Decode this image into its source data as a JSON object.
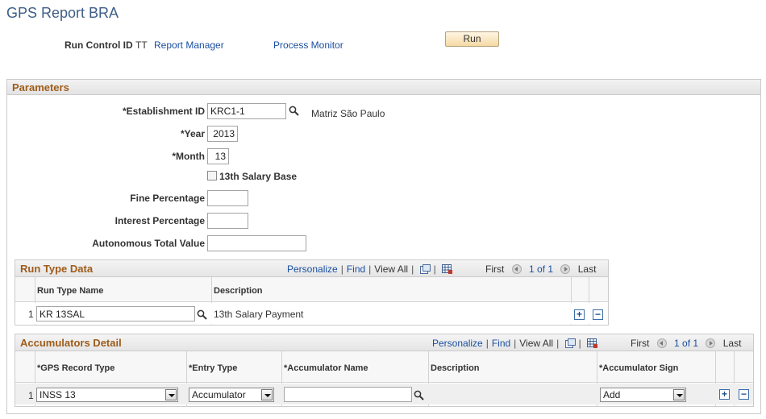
{
  "page": {
    "title": "GPS Report BRA"
  },
  "run_control": {
    "label": "Run Control ID",
    "value": "TT",
    "report_manager": "Report Manager",
    "process_monitor": "Process Monitor",
    "run_button": "Run"
  },
  "parameters": {
    "section_title": "Parameters",
    "establishment": {
      "label": "*Establishment ID",
      "value": "KRC1-1",
      "description": "Matriz São Paulo"
    },
    "year": {
      "label": "*Year",
      "value": "2013"
    },
    "month": {
      "label": "*Month",
      "value": "13"
    },
    "salary_base": {
      "label": "13th Salary Base",
      "checked": false
    },
    "fine_percentage": {
      "label": "Fine Percentage",
      "value": ""
    },
    "interest_percentage": {
      "label": "Interest Percentage",
      "value": ""
    },
    "autonomous_total": {
      "label": "Autonomous Total Value",
      "value": ""
    }
  },
  "run_type_grid": {
    "title": "Run Type Data",
    "nav": {
      "personalize": "Personalize",
      "find": "Find",
      "view_all": "View All",
      "first": "First",
      "count": "1 of 1",
      "last": "Last"
    },
    "columns": [
      "Run Type Name",
      "Description"
    ],
    "rows": [
      {
        "num": "1",
        "run_type_name": "KR 13SAL",
        "description": "13th Salary Payment"
      }
    ]
  },
  "accumulators_grid": {
    "title": "Accumulators Detail",
    "nav": {
      "personalize": "Personalize",
      "find": "Find",
      "view_all": "View All",
      "first": "First",
      "count": "1 of 1",
      "last": "Last"
    },
    "columns": [
      "*GPS Record Type",
      "*Entry Type",
      "*Accumulator Name",
      "Description",
      "*Accumulator Sign"
    ],
    "rows": [
      {
        "num": "1",
        "gps_record_type": "INSS 13",
        "entry_type": "Accumulator",
        "accumulator_name": "",
        "description": "",
        "accumulator_sign": "Add"
      }
    ]
  },
  "colors": {
    "title": "#3d5e87",
    "section_title": "#9e5c1a",
    "link": "#1a4fa0",
    "run_button": "#f5d9a4"
  }
}
